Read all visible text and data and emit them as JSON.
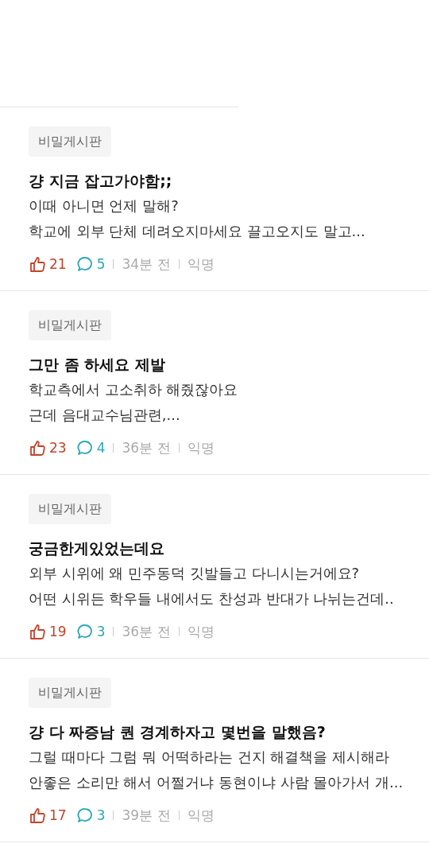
{
  "posts": [
    {
      "board": "비밀게시판",
      "title": "걍 지금 잡고가야함;;",
      "lines": [
        "이때 아니면 언제 말해?",
        "학교에 외부 단체 데려오지마세요 끌고오지도 말고..."
      ],
      "likes": "21",
      "comments": "5",
      "time": "34분 전",
      "author": "익명"
    },
    {
      "board": "비밀게시판",
      "title": "그만 좀 하세요 제발",
      "lines": [
        "학교측에서 고소취하 해줬잖아요",
        "근데 음대교수님관련,..."
      ],
      "likes": "23",
      "comments": "4",
      "time": "36분 전",
      "author": "익명"
    },
    {
      "board": "비밀게시판",
      "title": "궁금한게있었는데요",
      "lines": [
        "외부 시위에 왜 민주동덕 깃발들고 다니시는거에요?",
        "어떤 시위든 학우들 내에서도 찬성과 반대가 나뉘는건데.."
      ],
      "likes": "19",
      "comments": "3",
      "time": "36분 전",
      "author": "익명"
    },
    {
      "board": "비밀게시판",
      "title": "걍 다 짜증남 퀀 경계하자고 몇번을 말했음?",
      "lines": [
        "그럴 때마다 그럼 뭐 어떡하라는 건지 해결책을 제시해라",
        "안좋은 소리만 해서 어쩔거냐 동현이냐 사람 몰아가서 개..."
      ],
      "likes": "17",
      "comments": "3",
      "time": "39분 전",
      "author": "익명"
    }
  ]
}
